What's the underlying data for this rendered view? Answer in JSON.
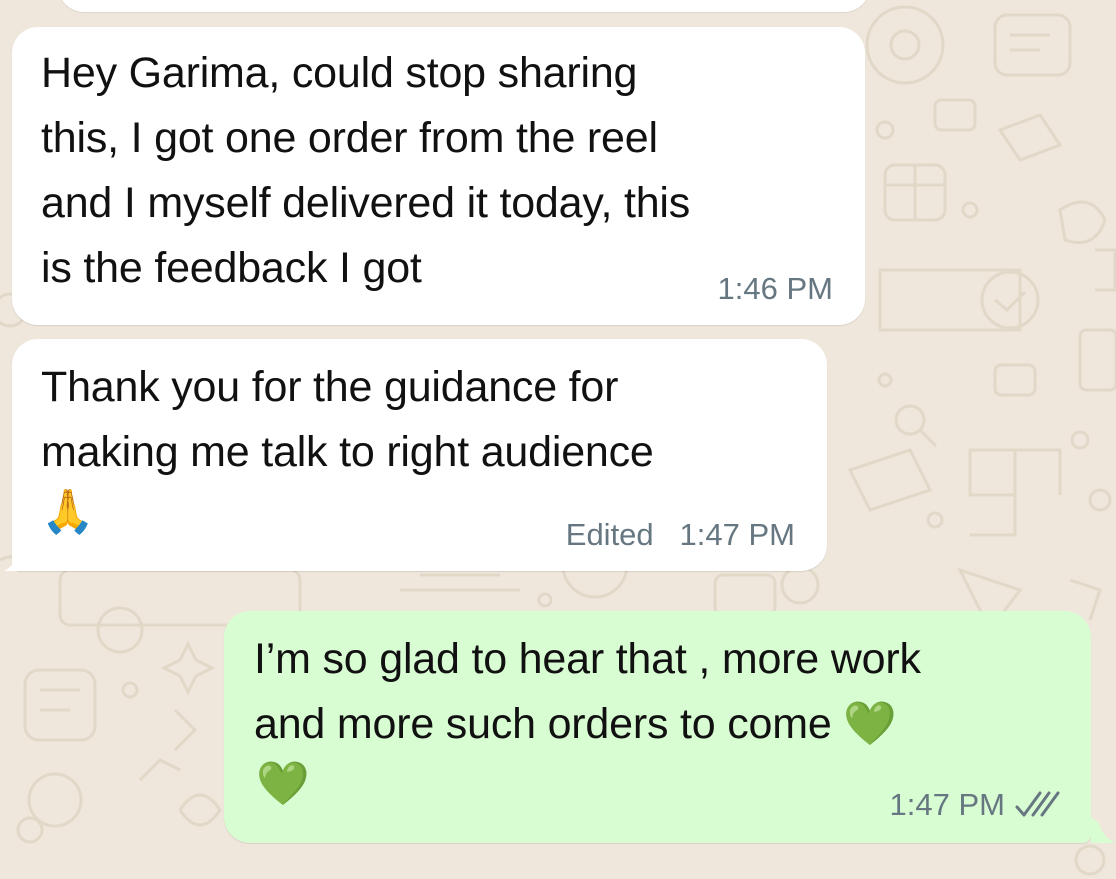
{
  "messages": [
    {
      "direction": "incoming",
      "text": "Hey Garima, could stop sharing\nthis, I got one order from the reel\nand I myself delivered it today, this\nis the feedback I got",
      "time": "1:46 PM"
    },
    {
      "direction": "incoming",
      "text": "Thank you for the guidance for\nmaking me talk to right audience",
      "emoji": "🙏",
      "edited_label": "Edited",
      "time": "1:47 PM"
    },
    {
      "direction": "outgoing",
      "text": "I’m so glad to hear that , more work\nand more such orders to come",
      "inline_emoji": "💚",
      "emoji": "💚",
      "time": "1:47 PM",
      "receipt_icon": "double-check-icon",
      "receipt_status": "delivered"
    }
  ],
  "colors": {
    "wallpaper": "#efe7dc",
    "incoming_bubble": "#ffffff",
    "outgoing_bubble": "#d9fdd3",
    "meta_text": "#667781"
  }
}
